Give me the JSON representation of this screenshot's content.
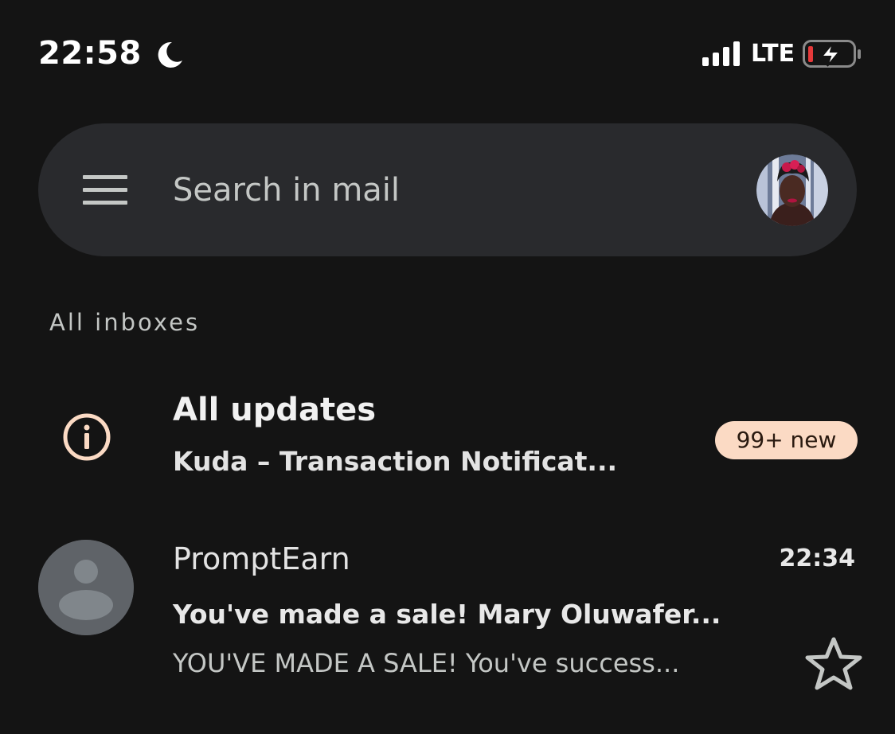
{
  "status_bar": {
    "time": "22:58",
    "network": "LTE",
    "icons": [
      "moon-icon",
      "signal-icon",
      "battery-charging-icon"
    ],
    "battery_low_color": "#e5393a"
  },
  "search": {
    "placeholder": "Search in mail",
    "menu_icon": "menu-icon",
    "account_avatar": "avatar"
  },
  "section": {
    "label": "All inboxes"
  },
  "updates": {
    "icon": "info-icon",
    "title": "All updates",
    "snippet": "Kuda – Transaction Notificat...",
    "badge": "99+ new",
    "badge_color": "#fbdac4"
  },
  "emails": [
    {
      "sender": "PromptEarn",
      "time": "22:34",
      "subject": "You've made a sale! Mary Oluwafer...",
      "preview": "YOU'VE MADE A SALE! You've success...",
      "starred": false
    }
  ],
  "colors": {
    "background": "#141414",
    "search_bar": "#292a2d",
    "default_avatar": "#5f6368"
  }
}
